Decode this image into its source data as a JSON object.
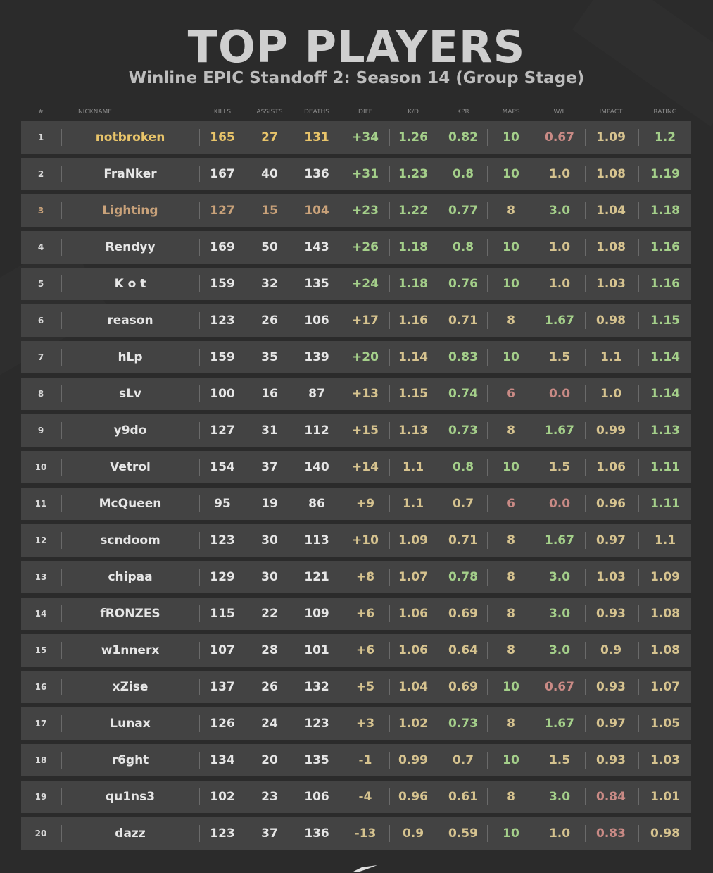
{
  "title": "TOP PLAYERS",
  "subtitle": "Winline EPIC Standoff 2: Season 14 (Group Stage)",
  "columns": [
    "#",
    "NICKNAME",
    "KILLS",
    "ASSISTS",
    "DEATHS",
    "DIFF",
    "K/D",
    "KPR",
    "MAPS",
    "W/L",
    "IMPACT",
    "RATING"
  ],
  "colors": {
    "gold": "#e8c46a",
    "bronze": "#c9a27a",
    "white": "#e6e6e6",
    "green": "#a4cf8a",
    "tan": "#d6c38f",
    "pink": "#c98a85",
    "rank": "#d9d9d9"
  },
  "rows": [
    {
      "rank": "1",
      "nickname": "notbroken",
      "kills": "165",
      "assists": "27",
      "deaths": "131",
      "diff": "+34",
      "kd": "1.26",
      "kpr": "0.82",
      "maps": "10",
      "wl": "0.67",
      "impact": "1.09",
      "rating": "1.2",
      "c": {
        "rank": "rank",
        "nickname": "gold",
        "kills": "gold",
        "assists": "gold",
        "deaths": "gold",
        "diff": "green",
        "kd": "green",
        "kpr": "green",
        "maps": "green",
        "wl": "pink",
        "impact": "tan",
        "rating": "green"
      }
    },
    {
      "rank": "2",
      "nickname": "FraNker",
      "kills": "167",
      "assists": "40",
      "deaths": "136",
      "diff": "+31",
      "kd": "1.23",
      "kpr": "0.8",
      "maps": "10",
      "wl": "1.0",
      "impact": "1.08",
      "rating": "1.19",
      "c": {
        "rank": "rank",
        "nickname": "white",
        "kills": "white",
        "assists": "white",
        "deaths": "white",
        "diff": "green",
        "kd": "green",
        "kpr": "green",
        "maps": "green",
        "wl": "tan",
        "impact": "tan",
        "rating": "green"
      }
    },
    {
      "rank": "3",
      "nickname": "Lighting",
      "kills": "127",
      "assists": "15",
      "deaths": "104",
      "diff": "+23",
      "kd": "1.22",
      "kpr": "0.77",
      "maps": "8",
      "wl": "3.0",
      "impact": "1.04",
      "rating": "1.18",
      "c": {
        "rank": "bronze",
        "nickname": "bronze",
        "kills": "bronze",
        "assists": "bronze",
        "deaths": "bronze",
        "diff": "green",
        "kd": "green",
        "kpr": "green",
        "maps": "tan",
        "wl": "green",
        "impact": "tan",
        "rating": "green"
      }
    },
    {
      "rank": "4",
      "nickname": "Rendyy",
      "kills": "169",
      "assists": "50",
      "deaths": "143",
      "diff": "+26",
      "kd": "1.18",
      "kpr": "0.8",
      "maps": "10",
      "wl": "1.0",
      "impact": "1.08",
      "rating": "1.16",
      "c": {
        "rank": "rank",
        "nickname": "white",
        "kills": "white",
        "assists": "white",
        "deaths": "white",
        "diff": "green",
        "kd": "green",
        "kpr": "green",
        "maps": "green",
        "wl": "tan",
        "impact": "tan",
        "rating": "green"
      }
    },
    {
      "rank": "5",
      "nickname": "K o t",
      "kills": "159",
      "assists": "32",
      "deaths": "135",
      "diff": "+24",
      "kd": "1.18",
      "kpr": "0.76",
      "maps": "10",
      "wl": "1.0",
      "impact": "1.03",
      "rating": "1.16",
      "c": {
        "rank": "rank",
        "nickname": "white",
        "kills": "white",
        "assists": "white",
        "deaths": "white",
        "diff": "green",
        "kd": "green",
        "kpr": "green",
        "maps": "green",
        "wl": "tan",
        "impact": "tan",
        "rating": "green"
      }
    },
    {
      "rank": "6",
      "nickname": "reason",
      "kills": "123",
      "assists": "26",
      "deaths": "106",
      "diff": "+17",
      "kd": "1.16",
      "kpr": "0.71",
      "maps": "8",
      "wl": "1.67",
      "impact": "0.98",
      "rating": "1.15",
      "c": {
        "rank": "rank",
        "nickname": "white",
        "kills": "white",
        "assists": "white",
        "deaths": "white",
        "diff": "tan",
        "kd": "tan",
        "kpr": "tan",
        "maps": "tan",
        "wl": "green",
        "impact": "tan",
        "rating": "green"
      }
    },
    {
      "rank": "7",
      "nickname": "hLp",
      "kills": "159",
      "assists": "35",
      "deaths": "139",
      "diff": "+20",
      "kd": "1.14",
      "kpr": "0.83",
      "maps": "10",
      "wl": "1.5",
      "impact": "1.1",
      "rating": "1.14",
      "c": {
        "rank": "rank",
        "nickname": "white",
        "kills": "white",
        "assists": "white",
        "deaths": "white",
        "diff": "green",
        "kd": "tan",
        "kpr": "green",
        "maps": "green",
        "wl": "tan",
        "impact": "tan",
        "rating": "green"
      }
    },
    {
      "rank": "8",
      "nickname": "sLv",
      "kills": "100",
      "assists": "16",
      "deaths": "87",
      "diff": "+13",
      "kd": "1.15",
      "kpr": "0.74",
      "maps": "6",
      "wl": "0.0",
      "impact": "1.0",
      "rating": "1.14",
      "c": {
        "rank": "rank",
        "nickname": "white",
        "kills": "white",
        "assists": "white",
        "deaths": "white",
        "diff": "tan",
        "kd": "tan",
        "kpr": "green",
        "maps": "pink",
        "wl": "pink",
        "impact": "tan",
        "rating": "green"
      }
    },
    {
      "rank": "9",
      "nickname": "y9do",
      "kills": "127",
      "assists": "31",
      "deaths": "112",
      "diff": "+15",
      "kd": "1.13",
      "kpr": "0.73",
      "maps": "8",
      "wl": "1.67",
      "impact": "0.99",
      "rating": "1.13",
      "c": {
        "rank": "rank",
        "nickname": "white",
        "kills": "white",
        "assists": "white",
        "deaths": "white",
        "diff": "tan",
        "kd": "tan",
        "kpr": "green",
        "maps": "tan",
        "wl": "green",
        "impact": "tan",
        "rating": "green"
      }
    },
    {
      "rank": "10",
      "nickname": "Vetrol",
      "kills": "154",
      "assists": "37",
      "deaths": "140",
      "diff": "+14",
      "kd": "1.1",
      "kpr": "0.8",
      "maps": "10",
      "wl": "1.5",
      "impact": "1.06",
      "rating": "1.11",
      "c": {
        "rank": "rank",
        "nickname": "white",
        "kills": "white",
        "assists": "white",
        "deaths": "white",
        "diff": "tan",
        "kd": "tan",
        "kpr": "green",
        "maps": "green",
        "wl": "tan",
        "impact": "tan",
        "rating": "green"
      }
    },
    {
      "rank": "11",
      "nickname": "McQueen",
      "kills": "95",
      "assists": "19",
      "deaths": "86",
      "diff": "+9",
      "kd": "1.1",
      "kpr": "0.7",
      "maps": "6",
      "wl": "0.0",
      "impact": "0.96",
      "rating": "1.11",
      "c": {
        "rank": "rank",
        "nickname": "white",
        "kills": "white",
        "assists": "white",
        "deaths": "white",
        "diff": "tan",
        "kd": "tan",
        "kpr": "tan",
        "maps": "pink",
        "wl": "pink",
        "impact": "tan",
        "rating": "green"
      }
    },
    {
      "rank": "12",
      "nickname": "scndoom",
      "kills": "123",
      "assists": "30",
      "deaths": "113",
      "diff": "+10",
      "kd": "1.09",
      "kpr": "0.71",
      "maps": "8",
      "wl": "1.67",
      "impact": "0.97",
      "rating": "1.1",
      "c": {
        "rank": "rank",
        "nickname": "white",
        "kills": "white",
        "assists": "white",
        "deaths": "white",
        "diff": "tan",
        "kd": "tan",
        "kpr": "tan",
        "maps": "tan",
        "wl": "green",
        "impact": "tan",
        "rating": "tan"
      }
    },
    {
      "rank": "13",
      "nickname": "chipaa",
      "kills": "129",
      "assists": "30",
      "deaths": "121",
      "diff": "+8",
      "kd": "1.07",
      "kpr": "0.78",
      "maps": "8",
      "wl": "3.0",
      "impact": "1.03",
      "rating": "1.09",
      "c": {
        "rank": "rank",
        "nickname": "white",
        "kills": "white",
        "assists": "white",
        "deaths": "white",
        "diff": "tan",
        "kd": "tan",
        "kpr": "green",
        "maps": "tan",
        "wl": "green",
        "impact": "tan",
        "rating": "tan"
      }
    },
    {
      "rank": "14",
      "nickname": "fRONZES",
      "kills": "115",
      "assists": "22",
      "deaths": "109",
      "diff": "+6",
      "kd": "1.06",
      "kpr": "0.69",
      "maps": "8",
      "wl": "3.0",
      "impact": "0.93",
      "rating": "1.08",
      "c": {
        "rank": "rank",
        "nickname": "white",
        "kills": "white",
        "assists": "white",
        "deaths": "white",
        "diff": "tan",
        "kd": "tan",
        "kpr": "tan",
        "maps": "tan",
        "wl": "green",
        "impact": "tan",
        "rating": "tan"
      }
    },
    {
      "rank": "15",
      "nickname": "w1nnerx",
      "kills": "107",
      "assists": "28",
      "deaths": "101",
      "diff": "+6",
      "kd": "1.06",
      "kpr": "0.64",
      "maps": "8",
      "wl": "3.0",
      "impact": "0.9",
      "rating": "1.08",
      "c": {
        "rank": "rank",
        "nickname": "white",
        "kills": "white",
        "assists": "white",
        "deaths": "white",
        "diff": "tan",
        "kd": "tan",
        "kpr": "tan",
        "maps": "tan",
        "wl": "green",
        "impact": "tan",
        "rating": "tan"
      }
    },
    {
      "rank": "16",
      "nickname": "xZise",
      "kills": "137",
      "assists": "26",
      "deaths": "132",
      "diff": "+5",
      "kd": "1.04",
      "kpr": "0.69",
      "maps": "10",
      "wl": "0.67",
      "impact": "0.93",
      "rating": "1.07",
      "c": {
        "rank": "rank",
        "nickname": "white",
        "kills": "white",
        "assists": "white",
        "deaths": "white",
        "diff": "tan",
        "kd": "tan",
        "kpr": "tan",
        "maps": "green",
        "wl": "pink",
        "impact": "tan",
        "rating": "tan"
      }
    },
    {
      "rank": "17",
      "nickname": "Lunax",
      "kills": "126",
      "assists": "24",
      "deaths": "123",
      "diff": "+3",
      "kd": "1.02",
      "kpr": "0.73",
      "maps": "8",
      "wl": "1.67",
      "impact": "0.97",
      "rating": "1.05",
      "c": {
        "rank": "rank",
        "nickname": "white",
        "kills": "white",
        "assists": "white",
        "deaths": "white",
        "diff": "tan",
        "kd": "tan",
        "kpr": "green",
        "maps": "tan",
        "wl": "green",
        "impact": "tan",
        "rating": "tan"
      }
    },
    {
      "rank": "18",
      "nickname": "r6ght",
      "kills": "134",
      "assists": "20",
      "deaths": "135",
      "diff": "-1",
      "kd": "0.99",
      "kpr": "0.7",
      "maps": "10",
      "wl": "1.5",
      "impact": "0.93",
      "rating": "1.03",
      "c": {
        "rank": "rank",
        "nickname": "white",
        "kills": "white",
        "assists": "white",
        "deaths": "white",
        "diff": "tan",
        "kd": "tan",
        "kpr": "tan",
        "maps": "green",
        "wl": "tan",
        "impact": "tan",
        "rating": "tan"
      }
    },
    {
      "rank": "19",
      "nickname": "qu1ns3",
      "kills": "102",
      "assists": "23",
      "deaths": "106",
      "diff": "-4",
      "kd": "0.96",
      "kpr": "0.61",
      "maps": "8",
      "wl": "3.0",
      "impact": "0.84",
      "rating": "1.01",
      "c": {
        "rank": "rank",
        "nickname": "white",
        "kills": "white",
        "assists": "white",
        "deaths": "white",
        "diff": "tan",
        "kd": "tan",
        "kpr": "tan",
        "maps": "tan",
        "wl": "green",
        "impact": "pink",
        "rating": "tan"
      }
    },
    {
      "rank": "20",
      "nickname": "dazz",
      "kills": "123",
      "assists": "37",
      "deaths": "136",
      "diff": "-13",
      "kd": "0.9",
      "kpr": "0.59",
      "maps": "10",
      "wl": "1.0",
      "impact": "0.83",
      "rating": "0.98",
      "c": {
        "rank": "rank",
        "nickname": "white",
        "kills": "white",
        "assists": "white",
        "deaths": "white",
        "diff": "tan",
        "kd": "tan",
        "kpr": "tan",
        "maps": "green",
        "wl": "tan",
        "impact": "pink",
        "rating": "tan"
      }
    }
  ]
}
